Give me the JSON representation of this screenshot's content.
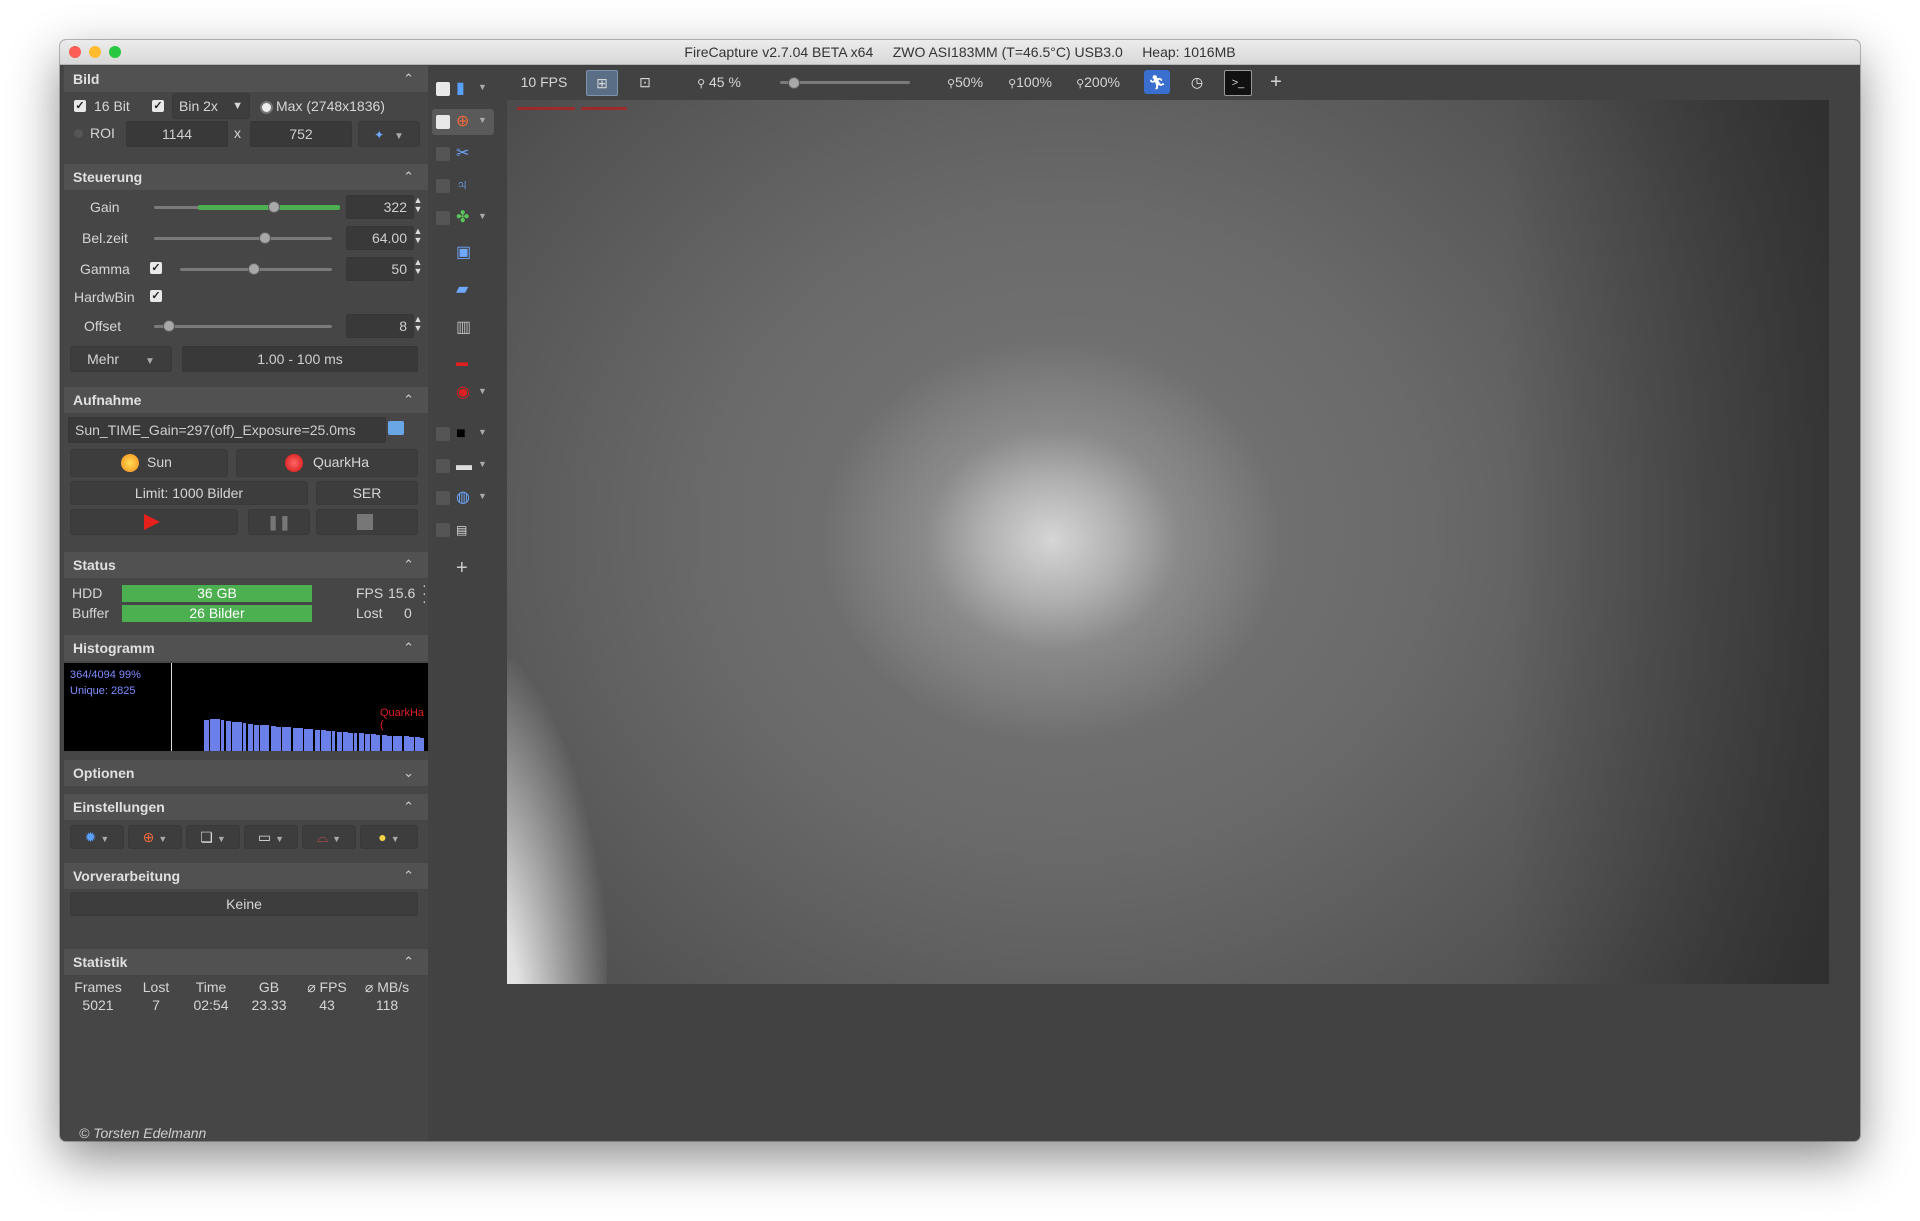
{
  "window": {
    "title": "FireCapture v2.7.04 BETA x64     ZWO ASI183MM (T=46.5°C) USB3.0     Heap: 1016MB"
  },
  "bild": {
    "title": "Bild",
    "bit_label": "16 Bit",
    "bin_value": "Bin 2x",
    "max_label": "Max (2748x1836)",
    "roi_label": "ROI",
    "roi_width": "1144",
    "roi_x": "x",
    "roi_height": "752"
  },
  "steuerung": {
    "title": "Steuerung",
    "gain_label": "Gain",
    "gain_value": "322",
    "gain_level": 0.64,
    "belzeit_label": "Bel.zeit",
    "belzeit_value": "64.00",
    "belzeit_level": 0.62,
    "gamma_label": "Gamma",
    "gamma_value": "50",
    "gamma_level": 0.48,
    "hardwbin_label": "HardwBin",
    "offset_label": "Offset",
    "offset_value": "8",
    "offset_level": 0.08,
    "mehr_label": "Mehr",
    "range_label": "1.00 - 100 ms"
  },
  "aufnahme": {
    "title": "Aufnahme",
    "filename": "Sun_TIME_Gain=297(off)_Exposure=25.0ms",
    "profile1": "Sun",
    "profile2": "QuarkHa",
    "limit_label": "Limit: 1000 Bilder",
    "format_label": "SER"
  },
  "status": {
    "title": "Status",
    "hdd_label": "HDD",
    "hdd_value": "36 GB",
    "buffer_label": "Buffer",
    "buffer_value": "26  Bilder",
    "fps_label": "FPS",
    "fps_value": "15.6",
    "lost_label": "Lost",
    "lost_value": "0"
  },
  "histogramm": {
    "title": "Histogramm",
    "info_line1": "364/4094 99%",
    "info_line2": "Unique: 2825",
    "profile_label": "QuarkHa (",
    "bars": [
      0.7,
      0.72,
      0.72,
      0.7,
      0.68,
      0.66,
      0.66,
      0.64,
      0.62,
      0.6,
      0.6,
      0.58,
      0.56,
      0.55,
      0.55,
      0.54,
      0.52,
      0.52,
      0.5,
      0.5,
      0.48,
      0.47,
      0.46,
      0.45,
      0.44,
      0.43,
      0.42,
      0.41,
      0.4,
      0.39,
      0.38,
      0.37,
      0.36,
      0.35,
      0.34,
      0.33,
      0.33,
      0.32,
      0.31,
      0.3
    ]
  },
  "optionen": {
    "title": "Optionen"
  },
  "einstellungen": {
    "title": "Einstellungen"
  },
  "vorverarbeitung": {
    "title": "Vorverarbeitung",
    "value": "Keine"
  },
  "statistik": {
    "title": "Statistik",
    "headers": [
      "Frames",
      "Lost",
      "Time",
      "GB",
      "⌀ FPS",
      "⌀ MB/s"
    ],
    "values": [
      "5021",
      "7",
      "02:54",
      "23.33",
      "43",
      "118"
    ]
  },
  "toolbar": {
    "fps": "10 FPS",
    "zoom": "45 %",
    "zoom_level": 0.1,
    "zoom50": "50%",
    "zoom100": "100%",
    "zoom200": "200%",
    "plus": "+"
  },
  "footer": {
    "copyright": "© Torsten Edelmann"
  },
  "colors": {
    "bar_green": "#4caf50",
    "histogram_blue": "#6b7fe8",
    "record_red": "#e8201c"
  }
}
